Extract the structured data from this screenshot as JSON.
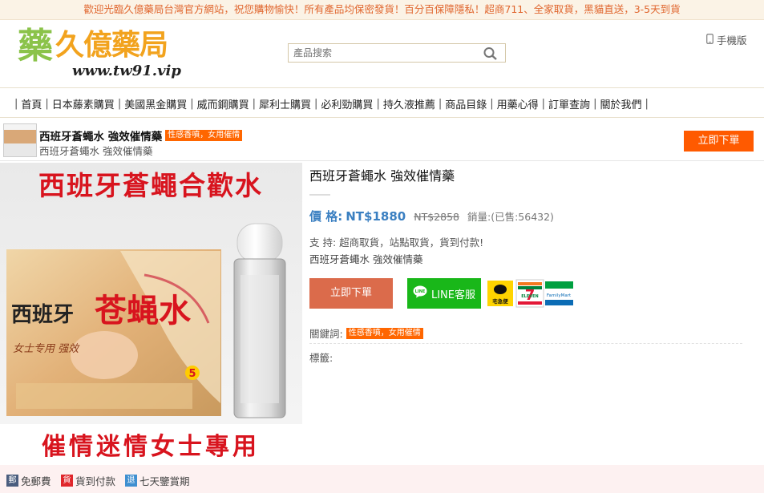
{
  "topbar": {
    "text": "歡迎光臨久億藥局台灣官方網站，祝您購物愉快！所有產品均保密發貨！百分百保障隱私！超商711、全家取貨，黑貓直送，3-5天到貨"
  },
  "logo": {
    "name_leaf": "藥",
    "name_rest": "久億藥局",
    "url": "www.tw91.vip"
  },
  "search": {
    "placeholder": "產品搜索"
  },
  "mobile": {
    "label": "手機版"
  },
  "nav": {
    "items": [
      "首頁",
      "日本藤素購買",
      "美國黑金購買",
      "威而鋼購買",
      "犀利士購買",
      "必利勁購買",
      "持久液推薦",
      "商品目錄",
      "用藥心得",
      "訂單查詢",
      "關於我們"
    ]
  },
  "sticky": {
    "title": "西班牙蒼蠅水 強效催情藥",
    "tag": "性感香噴，女用催情",
    "subtitle": "西班牙蒼蠅水 強效催情藥",
    "buy_label": "立即下單"
  },
  "product_image": {
    "top_banner": "西班牙蒼蠅合歡水",
    "box_text1": "西班牙",
    "box_text2": "苍蝇水",
    "box_text3": "女士专用 强效",
    "box_text4": "5",
    "bottom_banner": "催情迷情女士專用"
  },
  "product": {
    "title": "西班牙蒼蠅水 強效催情藥",
    "price_label": "價 格:",
    "price": "NT$1880",
    "old_price": "NT$2858",
    "sold": "銷量:(已售:56432)",
    "support": "支 持:  超商取貨，站點取貨，貨到付款!",
    "desc": "西班牙蒼蠅水 強效催情藥",
    "buy_label": "立即下單",
    "line_label": "LINE客服",
    "keywords_label": "關鍵詞:",
    "keyword_tag": "性感香噴，女用催情",
    "tags_label": "標籤:"
  },
  "shipping_logos": {
    "tcat": "宅急便",
    "seven": "ELEVEN",
    "family": "FamilyMart"
  },
  "footer": {
    "items": [
      {
        "icon": "郵",
        "label": "免郵費",
        "color": "#4a5d7e"
      },
      {
        "icon": "貨",
        "label": "貨到付款",
        "color": "#e0262b"
      },
      {
        "icon": "退",
        "label": "七天鑒賞期",
        "color": "#3f8fd0"
      }
    ]
  },
  "colors": {
    "accent_orange": "#ff5a00",
    "price_blue": "#3a7fc1",
    "line_green": "#19b719",
    "buy_button": "#db6b4b"
  }
}
